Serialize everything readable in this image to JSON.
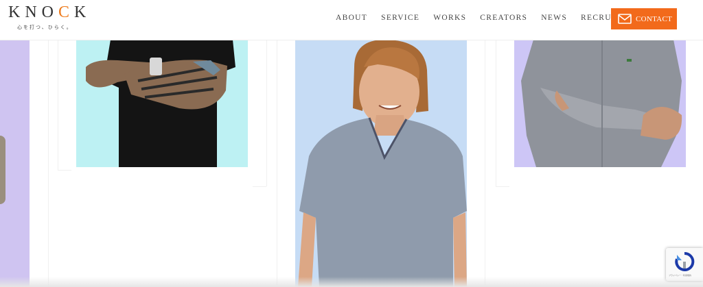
{
  "header": {
    "logo": {
      "part1": "KNO",
      "accent": "C",
      "part2": "K"
    },
    "tagline": "心を打つ、ひらく。",
    "nav": [
      "ABOUT",
      "SERVICE",
      "WORKS",
      "CREATORS",
      "NEWS",
      "RECRUIT"
    ],
    "contact_label": "CONTACT"
  },
  "colors": {
    "accent": "#f26a1b",
    "logo_accent": "#ee7c1e",
    "photo_bg_1": "#bdf1f3",
    "photo_bg_2": "#c6dcf5",
    "photo_bg_3": "#cdc6f6",
    "side_panel": "#cfc4f1"
  },
  "recaptcha": {
    "text": "プライバシー・利用規約"
  },
  "icons": {
    "contact": "mail-icon",
    "recaptcha": "recaptcha-icon"
  }
}
